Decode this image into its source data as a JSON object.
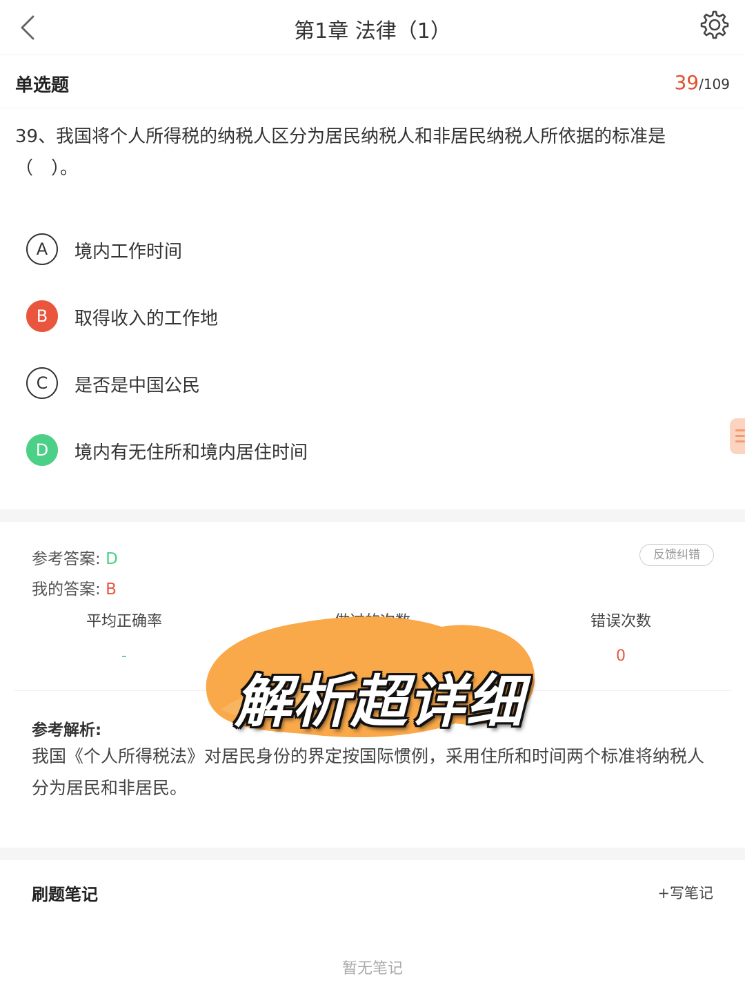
{
  "header": {
    "title": "第1章 法律（1）"
  },
  "question_header": {
    "type_label": "单选题",
    "current": "39",
    "total": "/109"
  },
  "question": {
    "text": "39、我国将个人所得税的纳税人区分为居民纳税人和非居民纳税人所依据的标准是（　）。"
  },
  "options": [
    {
      "letter": "A",
      "text": "境内工作时间",
      "state": "normal"
    },
    {
      "letter": "B",
      "text": "取得收入的工作地",
      "state": "selected-wrong"
    },
    {
      "letter": "C",
      "text": "是否是中国公民",
      "state": "normal"
    },
    {
      "letter": "D",
      "text": "境内有无住所和境内居住时间",
      "state": "correct"
    }
  ],
  "answer": {
    "reference_label": "参考答案:",
    "reference_value": "D",
    "mine_label": "我的答案:",
    "mine_value": "B",
    "feedback_label": "反馈纠错"
  },
  "stats": {
    "avg_label": "平均正确率",
    "avg_value": "-",
    "done_label": "做过的次数",
    "error_label": "错误次数",
    "error_value": "0"
  },
  "overlay": {
    "text": "解析超详细"
  },
  "analysis": {
    "title": "参考解析:",
    "body": "我国《个人所得税法》对居民身份的界定按国际惯例，采用住所和时间两个标准将纳税人分为居民和非居民。"
  },
  "notes": {
    "title": "刷题笔记",
    "write_label": "+写笔记",
    "empty_label": "暂无笔记"
  },
  "colors": {
    "accent_red": "#e9553d",
    "correct_green": "#4ccf87",
    "overlay_orange": "#f9a84a"
  },
  "icons": {
    "back": "chevron-left-icon",
    "settings": "gear-icon",
    "side_tab": "list-icon"
  }
}
